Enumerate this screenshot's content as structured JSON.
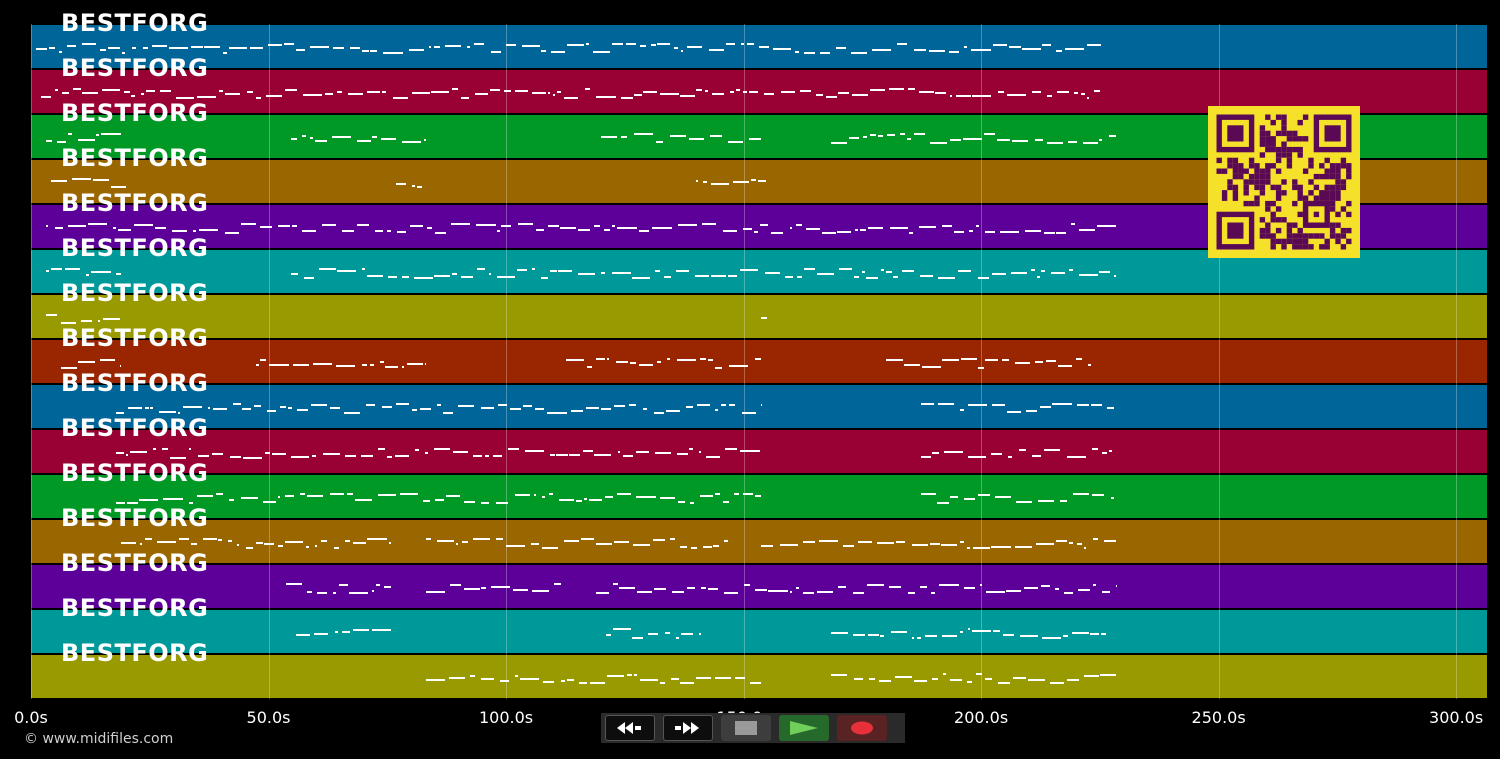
{
  "tracks": [
    {
      "name": "BESTFORG",
      "color": "#006699"
    },
    {
      "name": "BESTFORG",
      "color": "#990033"
    },
    {
      "name": "BESTFORG",
      "color": "#009926"
    },
    {
      "name": "BESTFORG",
      "color": "#996600"
    },
    {
      "name": "BESTFORG",
      "color": "#5c0099"
    },
    {
      "name": "BESTFORG",
      "color": "#009999"
    },
    {
      "name": "BESTFORG",
      "color": "#999900"
    },
    {
      "name": "BESTFORG",
      "color": "#992600"
    },
    {
      "name": "BESTFORG",
      "color": "#006699"
    },
    {
      "name": "BESTFORG",
      "color": "#990033"
    },
    {
      "name": "BESTFORG",
      "color": "#009926"
    },
    {
      "name": "BESTFORG",
      "color": "#996600"
    },
    {
      "name": "BESTFORG",
      "color": "#5c0099"
    },
    {
      "name": "BESTFORG",
      "color": "#009999"
    },
    {
      "name": "BESTFORG",
      "color": "#999900"
    }
  ],
  "timeline": {
    "range_seconds": [
      0,
      306.5
    ],
    "ticks": [
      {
        "value": 0,
        "label": "0.0s"
      },
      {
        "value": 50,
        "label": "50.0s"
      },
      {
        "value": 100,
        "label": "100.0s"
      },
      {
        "value": 150,
        "label": "150.0s"
      },
      {
        "value": 200,
        "label": "200.0s"
      },
      {
        "value": 250,
        "label": "250.0s"
      },
      {
        "value": 300,
        "label": "300.0s"
      }
    ]
  },
  "footer": {
    "copyright": "© www.midifiles.com"
  },
  "controls": {
    "prev": "rewind-icon",
    "next": "fast-forward-icon",
    "stop": "stop-icon",
    "play": "play-icon",
    "record": "record-icon"
  },
  "qr_code": {
    "colors": {
      "background": "#f6e12a",
      "modules": "#5a0a55"
    }
  }
}
